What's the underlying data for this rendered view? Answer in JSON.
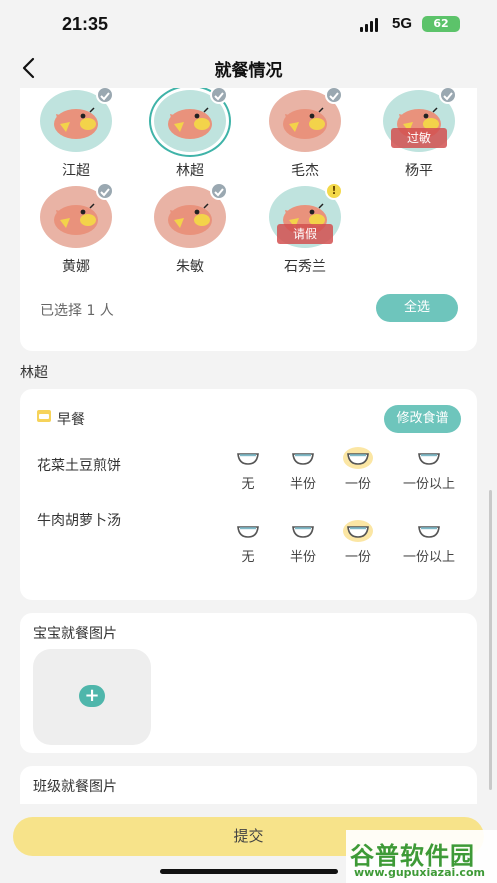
{
  "status_bar": {
    "time": "21:35",
    "network": "5G",
    "battery": "62"
  },
  "header": {
    "title": "就餐情况"
  },
  "children": [
    {
      "name": "江超",
      "bg": "#bfe3de",
      "badge": "check",
      "tag": ""
    },
    {
      "name": "林超",
      "bg": "#bfe3de",
      "badge": "check",
      "tag": "",
      "selected": true
    },
    {
      "name": "毛杰",
      "bg": "#e9b3a5",
      "badge": "check",
      "tag": ""
    },
    {
      "name": "杨平",
      "bg": "#bfe3de",
      "badge": "check",
      "tag": "过敏"
    },
    {
      "name": "黄娜",
      "bg": "#e9b3a5",
      "badge": "check",
      "tag": ""
    },
    {
      "name": "朱敏",
      "bg": "#e9b3a5",
      "badge": "check",
      "tag": ""
    },
    {
      "name": "石秀兰",
      "bg": "#bfe3de",
      "badge": "warn",
      "tag": "请假"
    }
  ],
  "selection": {
    "count_text": "已选择 1 人",
    "select_all": "全选"
  },
  "current_child": "林超",
  "meal": {
    "title": "早餐",
    "edit_menu": "修改食谱",
    "options": [
      "无",
      "半份",
      "一份",
      "一份以上"
    ],
    "dishes": [
      {
        "name": "花菜土豆煎饼",
        "selected": "一份"
      },
      {
        "name": "牛肉胡萝卜汤",
        "selected": "一份"
      }
    ]
  },
  "baby_photos": {
    "title": "宝宝就餐图片"
  },
  "class_photos": {
    "title": "班级就餐图片"
  },
  "submit": "提交",
  "watermark": {
    "big": "谷普软件园",
    "url": "www.gupuxiazai.com"
  },
  "colors": {
    "accent": "#6ec5bc",
    "submit": "#f7e38a",
    "avatar_teal": "#bfe3de",
    "avatar_pink": "#e9b3a5"
  }
}
